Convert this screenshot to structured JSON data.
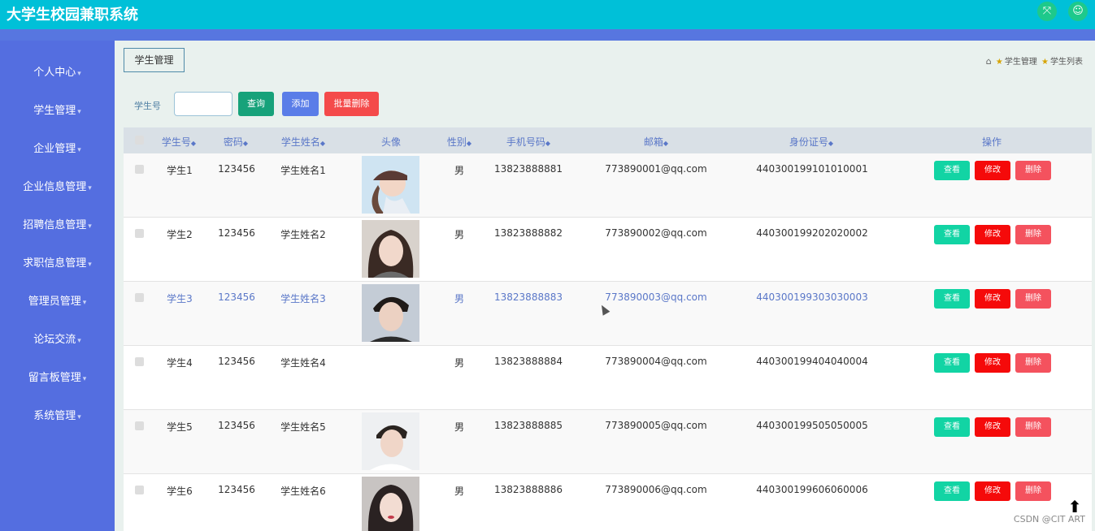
{
  "header": {
    "title": "大学生校园兼职系统",
    "icons": [
      "fullscreen-icon",
      "user-icon"
    ]
  },
  "sidebar": {
    "items": [
      {
        "label": "个人中心"
      },
      {
        "label": "学生管理"
      },
      {
        "label": "企业管理"
      },
      {
        "label": "企业信息管理"
      },
      {
        "label": "招聘信息管理"
      },
      {
        "label": "求职信息管理"
      },
      {
        "label": "管理员管理"
      },
      {
        "label": "论坛交流"
      },
      {
        "label": "留言板管理"
      },
      {
        "label": "系统管理"
      }
    ]
  },
  "main": {
    "tab_label": "学生管理",
    "breadcrumb": [
      "学生管理",
      "学生列表"
    ]
  },
  "search": {
    "label": "学生号",
    "value": "",
    "query_button": "查询",
    "add_button": "添加",
    "batch_delete_button": "批量删除"
  },
  "table": {
    "columns": [
      "学生号",
      "密码",
      "学生姓名",
      "头像",
      "性别",
      "手机号码",
      "邮箱",
      "身份证号",
      "操作"
    ],
    "rows": [
      {
        "student_id": "学生1",
        "password": "123456",
        "name": "学生姓名1",
        "gender": "男",
        "phone": "13823888881",
        "email": "773890001@qq.com",
        "id_card": "440300199101010001",
        "has_avatar": true
      },
      {
        "student_id": "学生2",
        "password": "123456",
        "name": "学生姓名2",
        "gender": "男",
        "phone": "13823888882",
        "email": "773890002@qq.com",
        "id_card": "440300199202020002",
        "has_avatar": true
      },
      {
        "student_id": "学生3",
        "password": "123456",
        "name": "学生姓名3",
        "gender": "男",
        "phone": "13823888883",
        "email": "773890003@qq.com",
        "id_card": "440300199303030003",
        "has_avatar": true
      },
      {
        "student_id": "学生4",
        "password": "123456",
        "name": "学生姓名4",
        "gender": "男",
        "phone": "13823888884",
        "email": "773890004@qq.com",
        "id_card": "440300199404040004",
        "has_avatar": false
      },
      {
        "student_id": "学生5",
        "password": "123456",
        "name": "学生姓名5",
        "gender": "男",
        "phone": "13823888885",
        "email": "773890005@qq.com",
        "id_card": "440300199505050005",
        "has_avatar": true
      },
      {
        "student_id": "学生6",
        "password": "123456",
        "name": "学生姓名6",
        "gender": "男",
        "phone": "13823888886",
        "email": "773890006@qq.com",
        "id_card": "440300199606060006",
        "has_avatar": true
      }
    ],
    "actions": {
      "view": "查看",
      "edit": "修改",
      "delete": "删除"
    }
  },
  "watermark": "CSDN @CIT ART",
  "colors": {
    "topbar": "#00c0d8",
    "sidebar": "#546ee0",
    "query": "#17a27a",
    "add": "#5a7de8",
    "danger": "#f44a4a",
    "view": "#12d4a4",
    "edit": "#f50a0a",
    "delete": "#f4525e"
  }
}
